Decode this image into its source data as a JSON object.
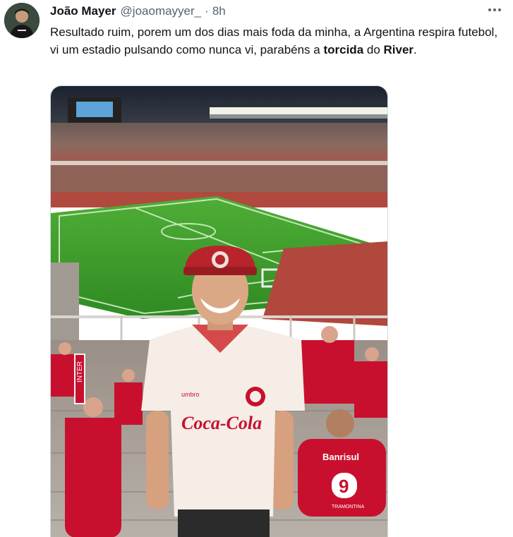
{
  "tweet": {
    "author_name": "João Mayer",
    "author_handle": "@joaomayyer_",
    "separator": "·",
    "timestamp": "8h",
    "text_part1": "Resultado ruim, porem um dos dias mais foda da minha, a Argentina respira futebol, vi um estadio pulsando como nunca vi, parabéns a ",
    "text_bold1": "torcida",
    "text_part2": " do ",
    "text_bold2": "River",
    "text_part3": ".",
    "more_icon": "more-horizontal-icon"
  },
  "photo": {
    "jersey_sponsor": "Coca-Cola",
    "jersey_brand": "umbro",
    "back_jersey_sponsor": "Banrisul",
    "back_jersey_number": "9",
    "back_jersey_text": "TRAMONTINA",
    "scarf_text": "INTER"
  },
  "colors": {
    "text_primary": "#0f1419",
    "text_secondary": "#536471",
    "pitch_green": "#3f9e2a",
    "inter_red": "#c8102e"
  }
}
